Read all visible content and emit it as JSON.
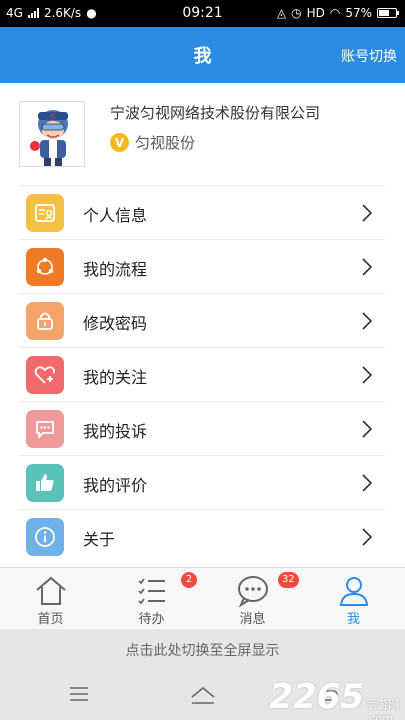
{
  "status_bar": {
    "network": "4G",
    "speed": "2.6K/s",
    "time": "09:21",
    "hd": "HD",
    "battery": "57%"
  },
  "header": {
    "title": "我",
    "switch_account": "账号切换"
  },
  "profile": {
    "company": "宁波匀视网络技术股份有限公司",
    "short_name": "匀视股份",
    "badge": "V"
  },
  "menu": {
    "items": [
      {
        "label": "个人信息",
        "icon": "id-card-icon",
        "color": "#f6c142"
      },
      {
        "label": "我的流程",
        "icon": "share-icon",
        "color": "#f07a26"
      },
      {
        "label": "修改密码",
        "icon": "lock-icon",
        "color": "#f2a46a"
      },
      {
        "label": "我的关注",
        "icon": "heart-plus-icon",
        "color": "#ef6a6a"
      },
      {
        "label": "我的投诉",
        "icon": "message-icon",
        "color": "#ef9a9a"
      },
      {
        "label": "我的评价",
        "icon": "thumbs-up-icon",
        "color": "#5bc0b8"
      },
      {
        "label": "关于",
        "icon": "info-icon",
        "color": "#6fb1e8"
      }
    ]
  },
  "tabbar": {
    "tabs": [
      {
        "label": "首页",
        "icon": "home-icon"
      },
      {
        "label": "待办",
        "icon": "todo-list-icon",
        "badge": "2"
      },
      {
        "label": "消息",
        "icon": "chat-bubble-icon",
        "badge": "32"
      },
      {
        "label": "我",
        "icon": "person-icon",
        "active": true
      }
    ]
  },
  "fullscreen_bar": "点击此处切换至全屏显示",
  "watermark": {
    "number": "2265",
    "text": "手游网",
    "dotcom": ".com"
  },
  "colors": {
    "primary": "#2b8ce3",
    "badge": "#ef4b3e"
  }
}
